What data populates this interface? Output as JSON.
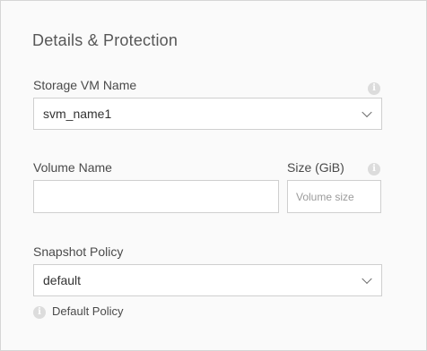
{
  "section": {
    "title": "Details & Protection"
  },
  "storage_vm": {
    "label": "Storage VM Name",
    "selected": "svm_name1",
    "info_icon": "info-icon"
  },
  "volume": {
    "name_label": "Volume Name",
    "name_value": "",
    "size_label": "Size (GiB)",
    "size_placeholder": "Volume size",
    "size_value": "",
    "info_icon": "info-icon"
  },
  "snapshot": {
    "label": "Snapshot Policy",
    "selected": "default",
    "hint_icon": "info-icon",
    "hint_text": "Default Policy"
  },
  "colors": {
    "panel_background": "#fafafa",
    "border": "#cfcfcf",
    "text": "#404040",
    "info_icon": "#dcdcdc"
  }
}
